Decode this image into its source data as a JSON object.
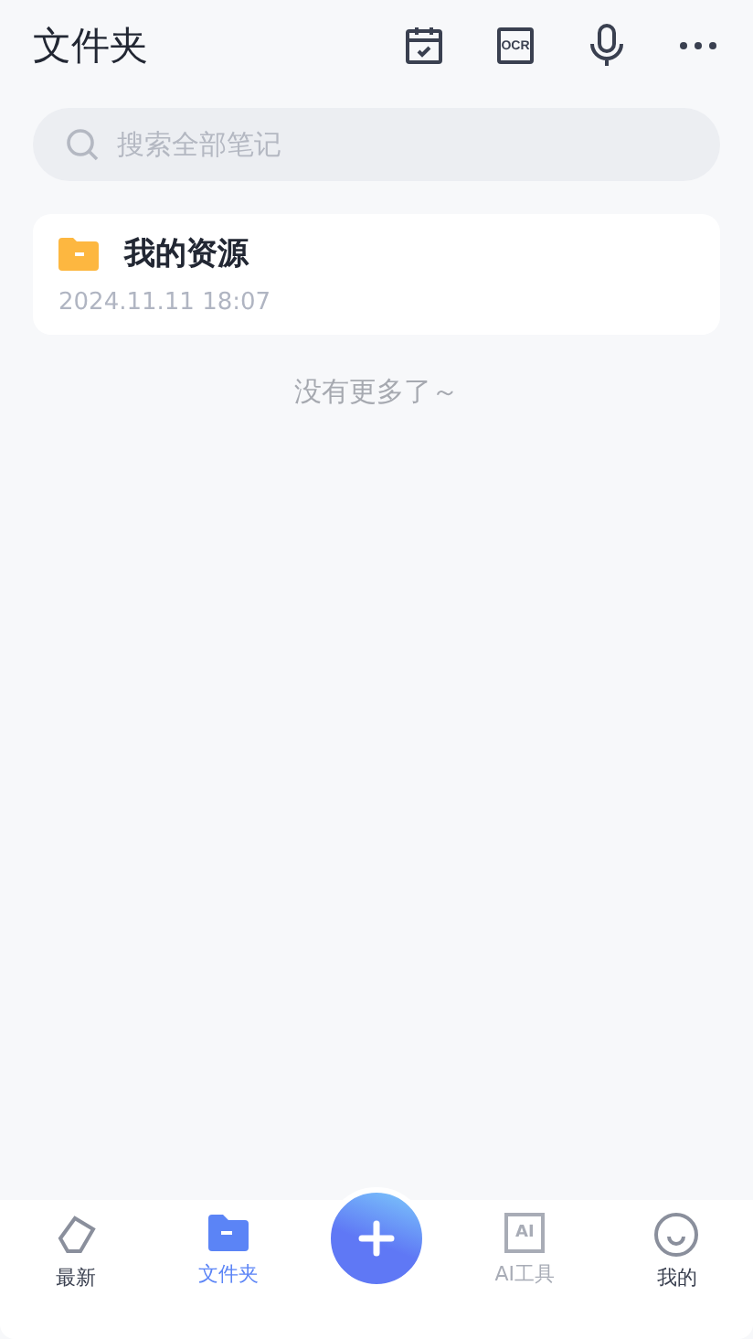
{
  "header": {
    "title": "文件夹",
    "actions": [
      {
        "kind": "calendar"
      },
      {
        "kind": "ocr",
        "text": "OCR"
      },
      {
        "kind": "mic"
      },
      {
        "kind": "more"
      }
    ]
  },
  "search": {
    "placeholder": "搜索全部笔记"
  },
  "folders": [
    {
      "name": "我的资源",
      "date": "2024.11.11 18:07"
    }
  ],
  "end_note": "没有更多了～",
  "tabs": [
    {
      "kind": "tag",
      "label": "最新",
      "selected": false,
      "disabled": false
    },
    {
      "kind": "folder",
      "label": "文件夹",
      "selected": true,
      "disabled": false
    },
    {
      "kind": "add"
    },
    {
      "kind": "ai",
      "label": "AI工具",
      "icon_text": "AI",
      "selected": false,
      "disabled": true
    },
    {
      "kind": "face",
      "label": "我的",
      "selected": false,
      "disabled": false
    }
  ]
}
